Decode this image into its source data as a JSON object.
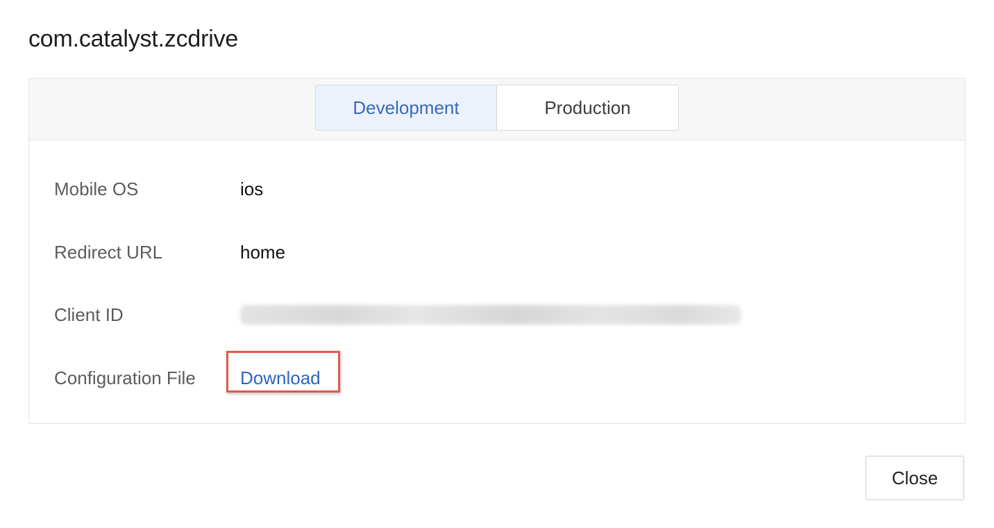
{
  "dialog": {
    "title": "com.catalyst.zcdrive",
    "close_label": "Close"
  },
  "tabs": [
    {
      "label": "Development",
      "active": true
    },
    {
      "label": "Production",
      "active": false
    }
  ],
  "details": {
    "mobile_os": {
      "label": "Mobile OS",
      "value": "ios"
    },
    "redirect_url": {
      "label": "Redirect URL",
      "value": "home"
    },
    "client_id": {
      "label": "Client ID",
      "value_redacted": true
    },
    "config_file": {
      "label": "Configuration File",
      "link_label": "Download"
    }
  },
  "colors": {
    "accent": "#3a69b8",
    "link": "#2f64c0",
    "active_tab_bg": "#ecf2fc",
    "highlight_box": "#e05a4a"
  }
}
